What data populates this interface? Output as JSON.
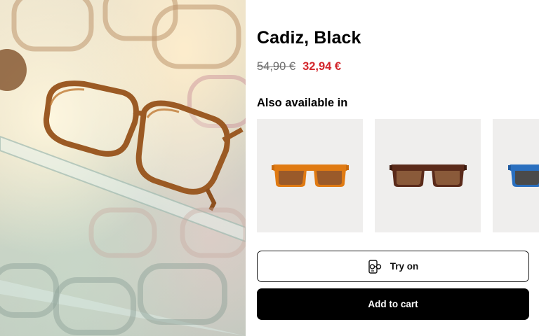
{
  "hero": {
    "image_description_icon": "eyeglasses-display-photo"
  },
  "product": {
    "title": "Cadiz, Black",
    "price_old": "54,90 €",
    "price_new": "32,94 €",
    "colors": {
      "sale_price": "#d3262c",
      "old_price": "#6e6e6e"
    }
  },
  "variants": {
    "label": "Also available in",
    "items": [
      {
        "name": "orange",
        "frame_color": "#e07a12",
        "lens_color": "#9a5a2a"
      },
      {
        "name": "brown",
        "frame_color": "#5a2a1a",
        "lens_color": "#8a5a3a"
      },
      {
        "name": "blue",
        "frame_color": "#2a6fbf",
        "lens_color": "#4a4a4a"
      }
    ]
  },
  "actions": {
    "try_on_label": "Try on",
    "try_on_icon": "face-glasses-icon",
    "add_to_cart_label": "Add to cart"
  }
}
